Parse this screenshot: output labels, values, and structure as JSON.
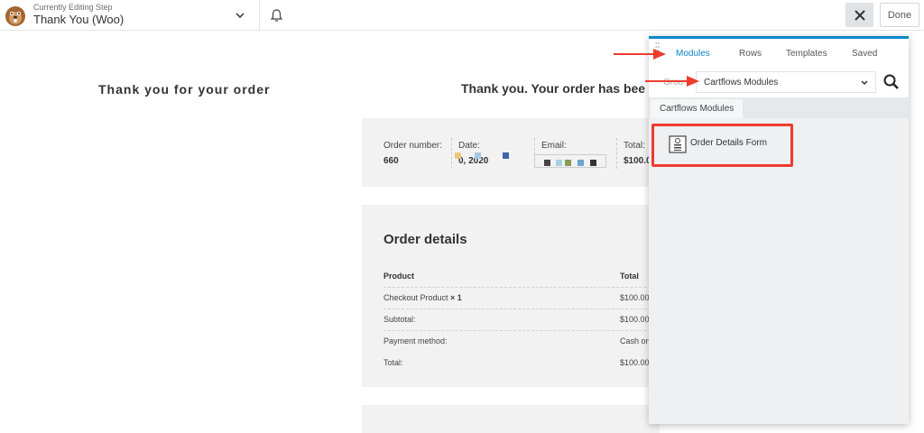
{
  "topbar": {
    "editing_label": "Currently Editing Step",
    "step_title": "Thank You (Woo)",
    "done_label": "Done"
  },
  "page": {
    "left_title": "Thank you for your order",
    "right_title": "Thank you. Your order has bee"
  },
  "order_overview": {
    "order_number_label": "Order number:",
    "order_number_value": "660",
    "date_label": "Date:",
    "date_value": "0, 2020",
    "email_label": "Email:",
    "total_label": "Total:",
    "total_value": "$100.0"
  },
  "order_details": {
    "title": "Order details",
    "header": {
      "product": "Product",
      "total": "Total"
    },
    "rows": [
      {
        "label": "Checkout Product",
        "qty": " × 1",
        "value": "$100.00"
      },
      {
        "label": "Subtotal:",
        "value": "$100.00"
      },
      {
        "label": "Payment method:",
        "value": "Cash on"
      },
      {
        "label": "Total:",
        "value": "$100.00"
      }
    ]
  },
  "panel": {
    "tabs": [
      "Modules",
      "Rows",
      "Templates",
      "Saved"
    ],
    "active_tab": "Modules",
    "group_label": "Grou",
    "group_value": "Cartflows Modules",
    "section_tab": "Cartflows Modules",
    "module_label": "Order Details Form"
  },
  "colors": {
    "accent": "#0e86c9",
    "annotation": "#ee3b2f"
  }
}
